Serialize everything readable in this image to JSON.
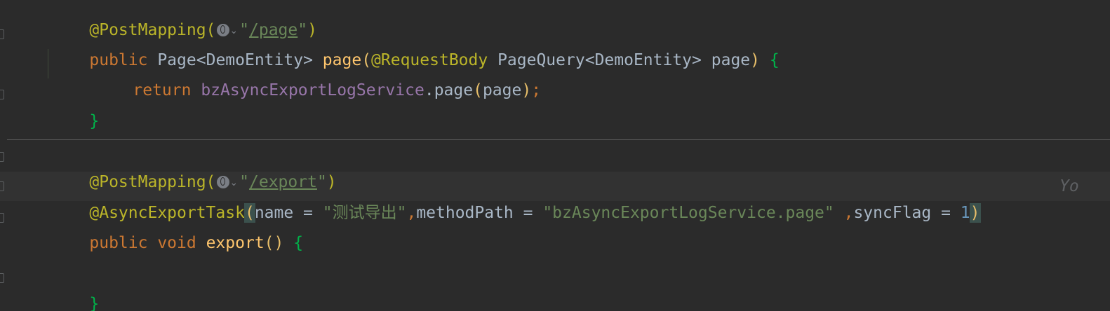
{
  "colors": {
    "background": "#2b2b2b",
    "keyword": "#cc7832",
    "annotation": "#bbb529",
    "string": "#6a8759",
    "function": "#ffc66d",
    "field": "#9876aa",
    "number": "#6897bb",
    "text": "#a9b7c6"
  },
  "icons": [
    "globe-icon",
    "chevron-down-icon"
  ],
  "code": {
    "line1": {
      "annotation": "@PostMapping(",
      "q1": "\"",
      "path": "/page",
      "q2": "\"",
      "close": ")"
    },
    "line2": {
      "kw_public": "public",
      "type_page": " Page",
      "lt": "<",
      "type_entity": "DemoEntity",
      "gt": ">",
      "sp": " ",
      "method": "page",
      "open": "(",
      "ann": "@RequestBody",
      "param_type": " PageQuery",
      "lt2": "<",
      "param_entity": "DemoEntity",
      "gt2": ">",
      "param_name": " page",
      "close": ")",
      "brace": " {"
    },
    "line3": {
      "kw_return": "return",
      "field": " bzAsyncExportLogService",
      "dot": ".",
      "call": "page",
      "open": "(",
      "arg": "page",
      "close": ")",
      "semi": ";"
    },
    "line4": {
      "brace": "}"
    },
    "line5": {
      "annotation": "@PostMapping(",
      "q1": "\"",
      "path": "/export",
      "q2": "\"",
      "close": ")"
    },
    "line6": {
      "annotation": "@AsyncExportTask",
      "open": "(",
      "name_key": "name = ",
      "name_val": "\"测试导出\"",
      "comma1": ",",
      "mp_key": "methodPath = ",
      "mp_val": "\"bzAsyncExportLogService.page\"",
      "comma2": " ,",
      "sf_key": "syncFlag = ",
      "sf_val": "1",
      "close": ")"
    },
    "line7": {
      "kw_public": "public",
      "kw_void": " void",
      "method": " export",
      "parens": "()",
      "brace": " {"
    },
    "line9": {
      "brace": "}"
    },
    "inlay_hint": "Yo"
  }
}
